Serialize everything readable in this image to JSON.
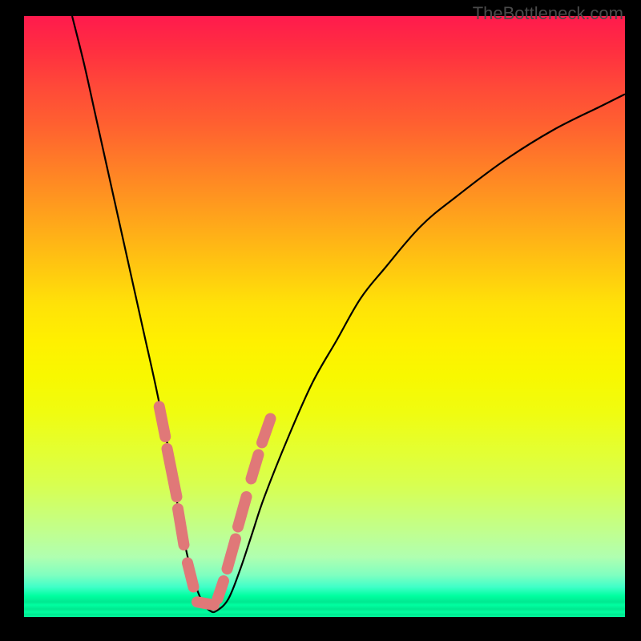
{
  "watermark": "TheBottleneck.com",
  "chart_data": {
    "type": "line",
    "title": "",
    "xlabel": "",
    "ylabel": "",
    "xlim": [
      0,
      100
    ],
    "ylim": [
      0,
      100
    ],
    "series": [
      {
        "name": "bottleneck-curve",
        "x": [
          8,
          10,
          12,
          14,
          16,
          18,
          20,
          22,
          24,
          25,
          26,
          27,
          28,
          29,
          30,
          31,
          32,
          34,
          36,
          38,
          40,
          44,
          48,
          52,
          56,
          60,
          66,
          72,
          80,
          88,
          96,
          100
        ],
        "y": [
          100,
          92,
          83,
          74,
          65,
          56,
          47,
          38,
          28,
          22,
          16,
          11,
          7,
          4,
          2,
          1,
          1,
          3,
          8,
          14,
          20,
          30,
          39,
          46,
          53,
          58,
          65,
          70,
          76,
          81,
          85,
          87
        ]
      }
    ],
    "markers": {
      "name": "highlighted-range",
      "segments": [
        {
          "side": "left",
          "x": [
            22.5,
            23.5
          ],
          "y": [
            35,
            30
          ]
        },
        {
          "side": "left",
          "x": [
            23.8,
            25.4
          ],
          "y": [
            28,
            20
          ]
        },
        {
          "side": "left",
          "x": [
            25.6,
            26.6
          ],
          "y": [
            18,
            12
          ]
        },
        {
          "side": "left",
          "x": [
            27.2,
            28.2
          ],
          "y": [
            9,
            5
          ]
        },
        {
          "side": "flat",
          "x": [
            28.8,
            31.6
          ],
          "y": [
            2.5,
            2
          ]
        },
        {
          "side": "right",
          "x": [
            32.2,
            33.2
          ],
          "y": [
            3,
            6
          ]
        },
        {
          "side": "right",
          "x": [
            33.8,
            35.2
          ],
          "y": [
            8,
            13
          ]
        },
        {
          "side": "right",
          "x": [
            35.6,
            37.0
          ],
          "y": [
            15,
            20
          ]
        },
        {
          "side": "right",
          "x": [
            37.8,
            39.0
          ],
          "y": [
            23,
            27
          ]
        },
        {
          "side": "right",
          "x": [
            39.6,
            41.0
          ],
          "y": [
            29,
            33
          ]
        }
      ]
    },
    "background_gradient": {
      "top": "#ff1a4d",
      "mid": "#fff000",
      "bottom": "#00ffa0"
    }
  }
}
